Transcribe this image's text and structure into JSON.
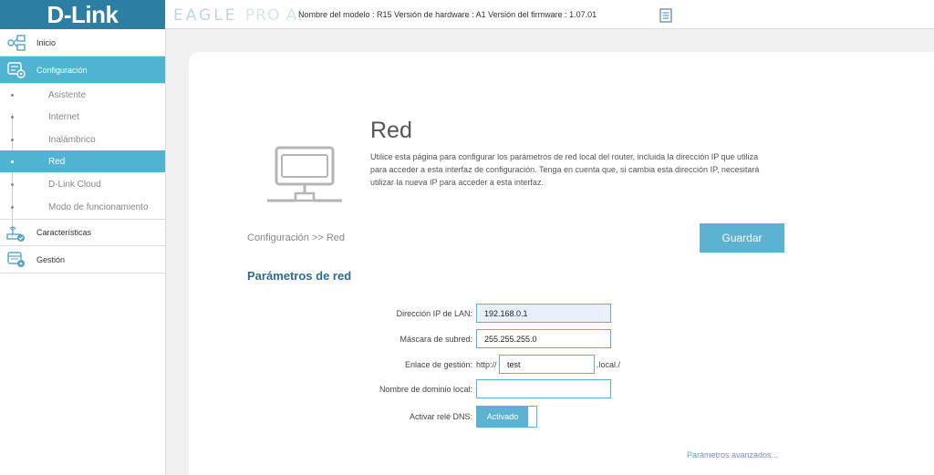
{
  "header": {
    "logo": "D-Link",
    "product_main": "EAGLE",
    "product_sub": "PRO AI",
    "model_info": "Nombre del modelo : R15 Versión de hardware : A1 Versión del firmware : 1.07.01"
  },
  "sidebar": {
    "items": [
      {
        "label": "Inicio",
        "icon": "network-map-icon"
      },
      {
        "label": "Configuración",
        "icon": "settings-icon",
        "active": true
      },
      {
        "label": "Características",
        "icon": "router-features-icon"
      },
      {
        "label": "Gestión",
        "icon": "management-icon"
      }
    ],
    "subitems": [
      {
        "label": "Asistente"
      },
      {
        "label": "Internet"
      },
      {
        "label": "Inalámbrico"
      },
      {
        "label": "Red",
        "active": true
      },
      {
        "label": "D-Link Cloud"
      },
      {
        "label": "Modo de funcionamiento"
      }
    ]
  },
  "main": {
    "title": "Red",
    "description": "Utilice esta página para configurar los parámetros de red local del router, incluida la dirección IP que utiliza para acceder a esta interfaz de configuración. Tenga en cuenta que, si cambia esta dirección IP, necesitará utilizar la nueva IP para acceder a esta interfaz.",
    "breadcrumb": "Configuración >> Red",
    "save_label": "Guardar",
    "section_title": "Parámetros de red",
    "fields": {
      "lan_ip": {
        "label": "Dirección IP de LAN:",
        "value": "192.168.0.1"
      },
      "subnet": {
        "label": "Máscara de subred:",
        "value": "255.255.255.0"
      },
      "mgmt_link": {
        "label": "Enlace de gestión:",
        "prefix": "http://",
        "value": "test",
        "suffix": ".local./"
      },
      "local_domain": {
        "label": "Nombre de dominio local:",
        "value": ""
      },
      "dns_relay": {
        "label": "Activar relé DNS:",
        "state": "Activado"
      }
    },
    "advanced_link": "Parámetros avanzados..."
  },
  "colors": {
    "brand": "#2c7fa2",
    "accent": "#4fb3d1",
    "button": "#5bb3d1",
    "section_title": "#2c6e8e"
  }
}
